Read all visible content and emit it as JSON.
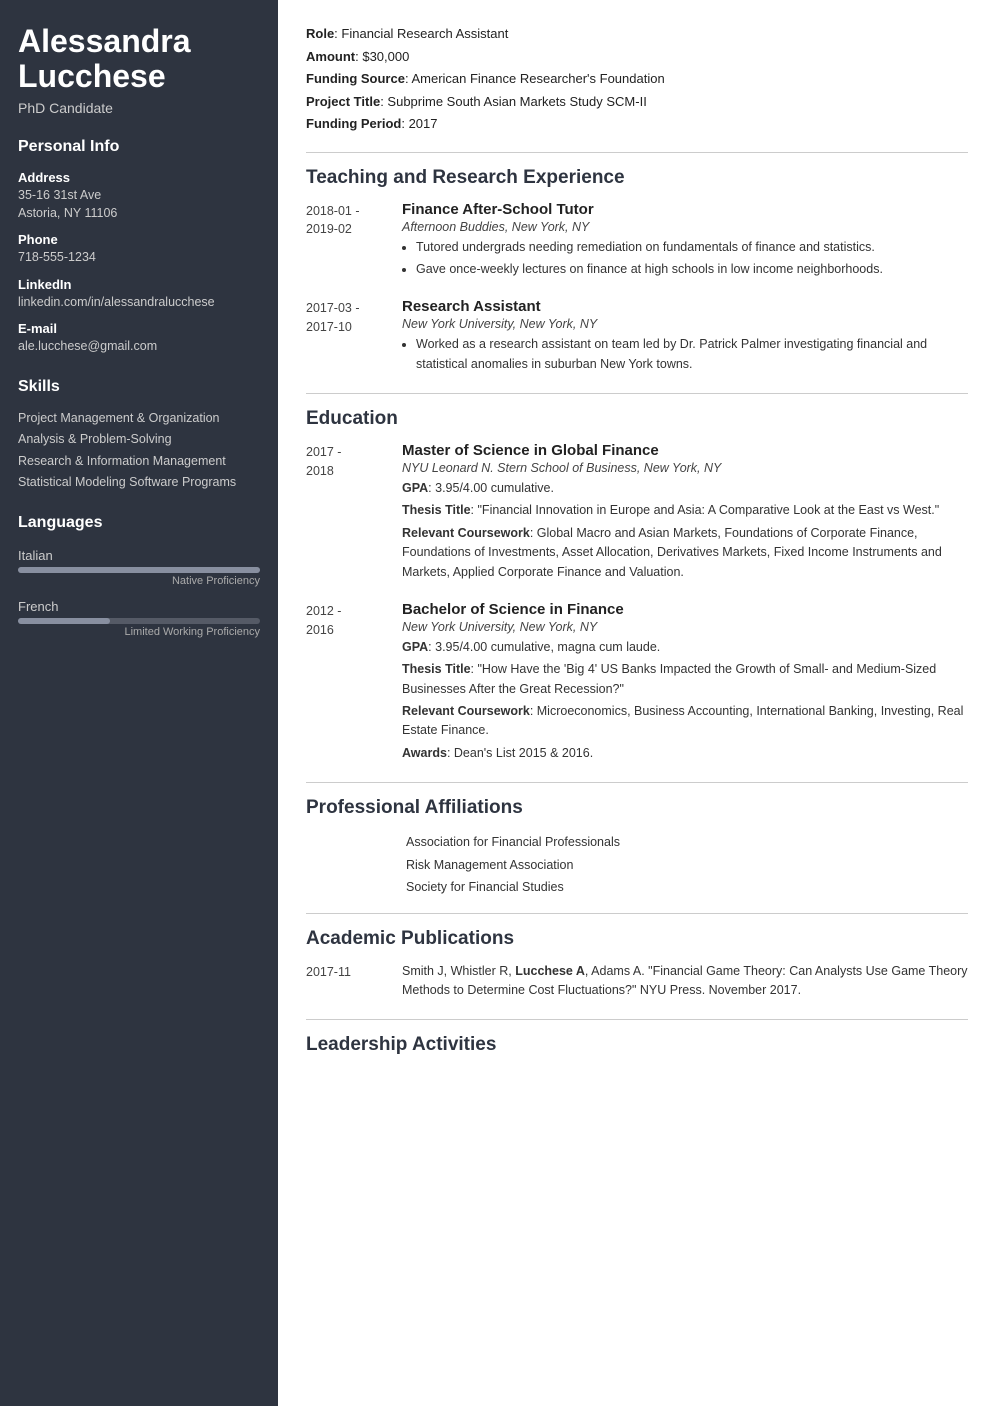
{
  "sidebar": {
    "name_line1": "Alessandra",
    "name_line2": "Lucchese",
    "title": "PhD Candidate",
    "personal_info_title": "Personal Info",
    "address_label": "Address",
    "address_value": "35-16 31st Ave\nAstoria, NY 11106",
    "phone_label": "Phone",
    "phone_value": "718-555-1234",
    "linkedin_label": "LinkedIn",
    "linkedin_value": "linkedin.com/in/alessandralucchese",
    "email_label": "E-mail",
    "email_value": "ale.lucchese@gmail.com",
    "skills_title": "Skills",
    "skills": [
      "Project Management & Organization",
      "Analysis & Problem-Solving",
      "Research & Information Management",
      "Statistical Modeling Software Programs"
    ],
    "languages_title": "Languages",
    "languages": [
      {
        "name": "Italian",
        "fill_percent": 100,
        "level": "Native Proficiency"
      },
      {
        "name": "French",
        "fill_percent": 38,
        "level": "Limited Working Proficiency"
      }
    ]
  },
  "main": {
    "grant": {
      "role_label": "Role",
      "role_value": "Financial Research Assistant",
      "amount_label": "Amount",
      "amount_value": "$30,000",
      "funding_source_label": "Funding Source",
      "funding_source_value": "American Finance Researcher's Foundation",
      "project_title_label": "Project Title",
      "project_title_value": "Subprime South Asian Markets Study SCM-II",
      "funding_period_label": "Funding Period",
      "funding_period_value": "2017"
    },
    "teaching_section_title": "Teaching and Research Experience",
    "teaching_entries": [
      {
        "date": "2018-01 -\n2019-02",
        "title": "Finance After-School Tutor",
        "org": "Afternoon Buddies, New York, NY",
        "bullets": [
          "Tutored undergrads needing remediation on fundamentals of finance and statistics.",
          "Gave once-weekly lectures on finance at high schools in low income neighborhoods."
        ]
      },
      {
        "date": "2017-03 -\n2017-10",
        "title": "Research Assistant",
        "org": "New York University, New York, NY",
        "bullets": [
          "Worked as a research assistant on team led by Dr. Patrick Palmer investigating financial and statistical anomalies in suburban New York towns."
        ]
      }
    ],
    "education_section_title": "Education",
    "education_entries": [
      {
        "date": "2017 -\n2018",
        "title": "Master of Science in Global Finance",
        "org": "NYU Leonard N. Stern School of Business, New York, NY",
        "body_parts": [
          {
            "label": "GPA",
            "value": "3.95/4.00 cumulative."
          },
          {
            "label": "Thesis Title",
            "value": ": \"Financial Innovation in Europe and Asia: A Comparative Look at the East vs West.\""
          },
          {
            "label": "Relevant Coursework",
            "value": ": Global Macro and Asian Markets, Foundations of Corporate Finance, Foundations of Investments, Asset Allocation, Derivatives Markets, Fixed Income Instruments and Markets, Applied Corporate Finance and Valuation."
          }
        ]
      },
      {
        "date": "2012 -\n2016",
        "title": "Bachelor of Science in Finance",
        "org": "New York University, New York, NY",
        "body_parts": [
          {
            "label": "GPA",
            "value": "3.95/4.00 cumulative, magna cum laude."
          },
          {
            "label": "Thesis Title",
            "value": ": \"How Have the 'Big 4' US Banks Impacted the Growth of Small- and Medium-Sized Businesses After the Great Recession?\""
          },
          {
            "label": "Relevant Coursework",
            "value": ": Microeconomics, Business Accounting, International Banking, Investing, Real Estate Finance."
          },
          {
            "label": "Awards",
            "value": ": Dean's List 2015 & 2016."
          }
        ]
      }
    ],
    "affiliations_section_title": "Professional Affiliations",
    "affiliations": [
      "Association for Financial Professionals",
      "Risk Management Association",
      "Society for Financial Studies"
    ],
    "publications_section_title": "Academic Publications",
    "publications": [
      {
        "date": "2017-11",
        "text_before_bold": "Smith J, Whistler R, ",
        "bold_text": "Lucchese A",
        "text_after_bold": ", Adams A. “Financial Game Theory: Can Analysts Use Game Theory Methods to Determine Cost Fluctuations?” NYU Press. November 2017."
      }
    ],
    "leadership_section_title": "Leadership Activities"
  }
}
